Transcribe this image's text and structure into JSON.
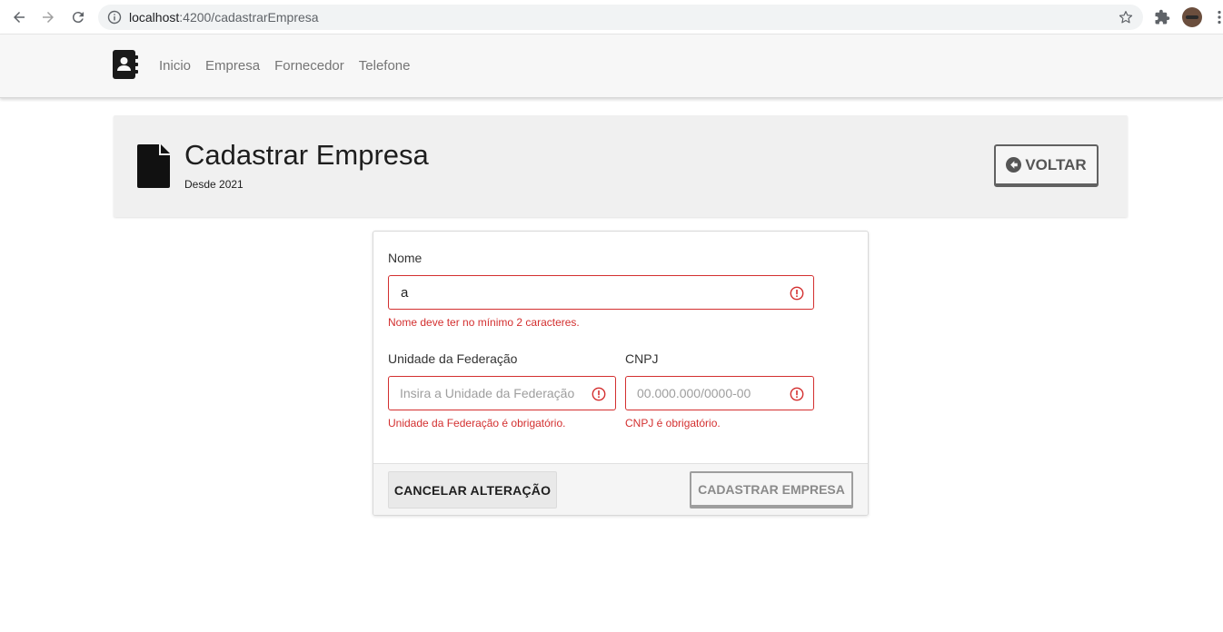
{
  "browser": {
    "url_host": "localhost",
    "url_path": ":4200/cadastrarEmpresa",
    "icons": [
      "back-arrow-icon",
      "forward-arrow-icon",
      "reload-icon",
      "info-icon",
      "star-icon",
      "puzzle-extension-icon",
      "kebab-menu-icon"
    ]
  },
  "navbar": {
    "brand_icon": "address-book-icon",
    "links": [
      {
        "label": "Inicio"
      },
      {
        "label": "Empresa"
      },
      {
        "label": "Fornecedor"
      },
      {
        "label": "Telefone"
      }
    ]
  },
  "header": {
    "icon": "document-icon",
    "title": "Cadastrar Empresa",
    "subtitle": "Desde 2021",
    "back_button": {
      "label": "VOLTAR",
      "icon": "arrow-circle-left-icon"
    }
  },
  "form": {
    "nome": {
      "label": "Nome",
      "value": "a",
      "placeholder": "",
      "error": "Nome deve ter no mínimo 2 caracteres."
    },
    "uf": {
      "label": "Unidade da Federação",
      "value": "",
      "placeholder": "Insira a Unidade da Federação",
      "error": "Unidade da Federação é obrigatório."
    },
    "cnpj": {
      "label": "CNPJ",
      "value": "",
      "placeholder": "00.000.000/0000-00",
      "error": "CNPJ é obrigatório."
    },
    "cancel_label": "CANCELAR ALTERAÇÃO",
    "submit_label": "CADASTRAR EMPRESA"
  },
  "colors": {
    "error": "#d32f2f",
    "navbar_bg": "#f7f7f7",
    "header_bg": "#f0f0f0",
    "text_dark": "#1e1e1e"
  }
}
